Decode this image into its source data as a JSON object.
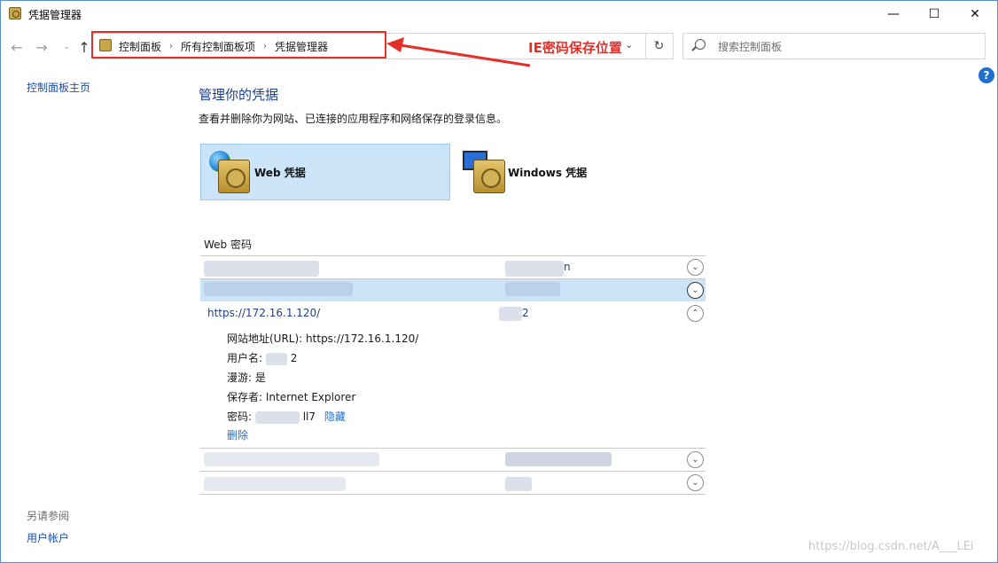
{
  "window": {
    "title": "凭据管理器",
    "controls": {
      "minimize": "—",
      "maximize": "☐",
      "close": "✕"
    }
  },
  "nav": {
    "back": "←",
    "forward": "→",
    "dropdown": "⌄",
    "up": "↑",
    "refresh": "↻"
  },
  "breadcrumb": {
    "items": [
      "控制面板",
      "所有控制面板项",
      "凭据管理器"
    ],
    "separator": "›",
    "dropdown": "⌄"
  },
  "search": {
    "placeholder": "搜索控制面板"
  },
  "annotation": {
    "label": "IE密码保存位置",
    "color": "#e5302a"
  },
  "help": {
    "glyph": "?"
  },
  "left_pane": {
    "home_link": "控制面板主页",
    "see_also_title": "另请参阅",
    "user_accounts": "用户帐户"
  },
  "main": {
    "title": "管理你的凭据",
    "description": "查看并删除你为网站、已连接的应用程序和网络保存的登录信息。",
    "tiles": [
      {
        "label": "Web 凭据",
        "selected": true
      },
      {
        "label": "Windows 凭据",
        "selected": false
      }
    ],
    "section_title": "Web 密码",
    "rows": [
      {
        "url_visible": "",
        "user_visible": "n",
        "expanded": false
      },
      {
        "url_visible": "",
        "user_visible": "",
        "expanded": false,
        "selected": true
      },
      {
        "url_visible": "https://172.16.1.120/",
        "user_visible": "2",
        "expanded": true
      },
      {
        "url_visible": "",
        "user_visible": "",
        "expanded": false
      },
      {
        "url_visible": "",
        "user_visible": "",
        "expanded": false
      }
    ],
    "detail": {
      "url_label": "网站地址(URL):",
      "url_value": "https://172.16.1.120/",
      "user_label": "用户名:",
      "user_value_visible": "2",
      "roaming_label": "漫游:",
      "roaming_value": "是",
      "saved_by_label": "保存者:",
      "saved_by_value": "Internet Explorer",
      "password_label": "密码:",
      "password_visible": "ll7",
      "hide_link": "隐藏",
      "delete_link": "删除"
    }
  },
  "watermark": "https://blog.csdn.net/A___LEi"
}
